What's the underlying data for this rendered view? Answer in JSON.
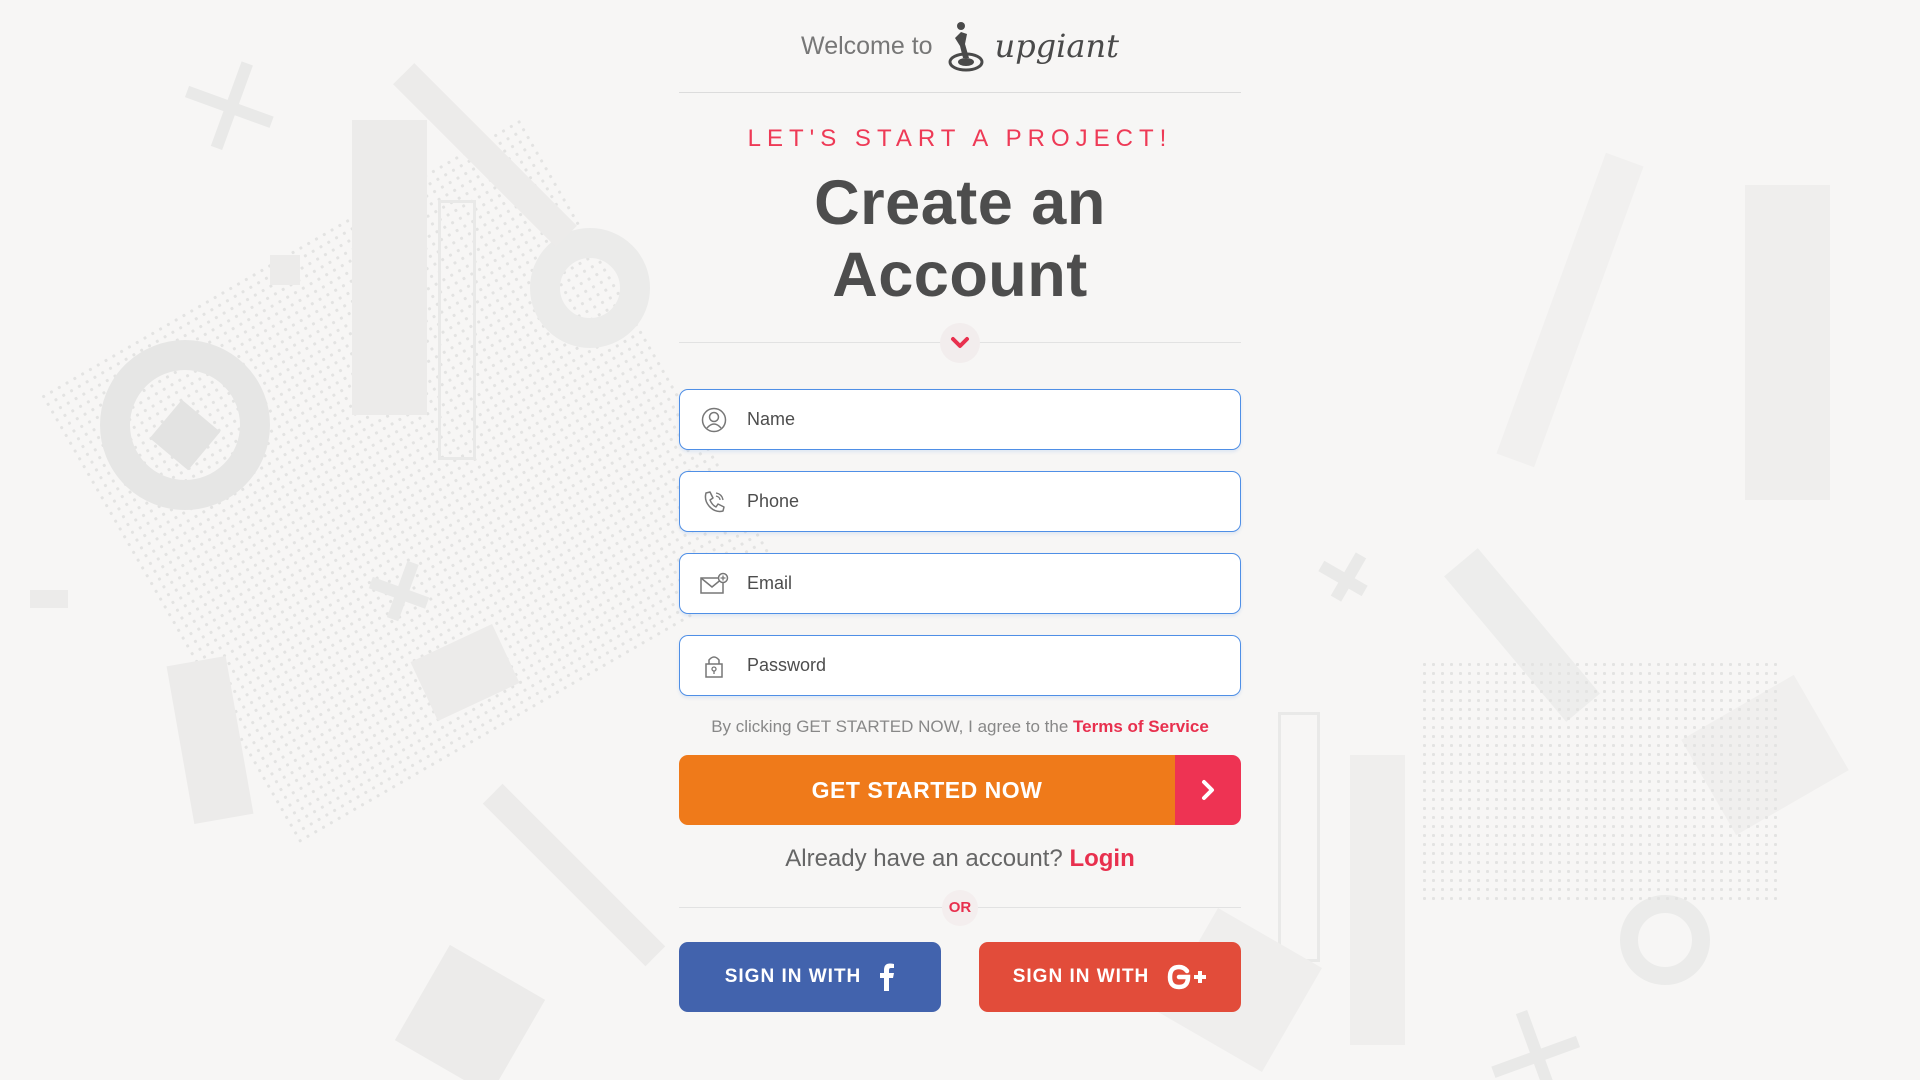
{
  "header": {
    "welcome_text": "Welcome to",
    "logo_text": "upgiant"
  },
  "hero": {
    "kicker": "LET'S START A PROJECT!",
    "title": "Create an Account"
  },
  "form": {
    "name_placeholder": "Name",
    "phone_placeholder": "Phone",
    "email_placeholder": "Email",
    "password_placeholder": "Password"
  },
  "terms": {
    "prefix": "By clicking GET STARTED NOW, I agree to the ",
    "link": "Terms of Service"
  },
  "cta": {
    "label": "GET STARTED NOW"
  },
  "login": {
    "prompt": "Already have an account? ",
    "link": "Login"
  },
  "or_label": "OR",
  "social": {
    "facebook_label": "SIGN IN WITH",
    "google_label": "SIGN IN WITH"
  },
  "colors": {
    "accent_red": "#ee3353",
    "cta_orange": "#ef7a1a",
    "facebook_blue": "#4263ad",
    "google_red": "#e24c3a",
    "field_border": "#4f8fe6"
  },
  "icons": {
    "logo": "person-target-icon",
    "name": "user-icon",
    "phone": "phone-icon",
    "email": "envelope-icon",
    "password": "lock-icon",
    "divider": "chevron-down-icon",
    "cta": "chevron-right-icon",
    "facebook": "facebook-icon",
    "google": "google-plus-icon"
  }
}
